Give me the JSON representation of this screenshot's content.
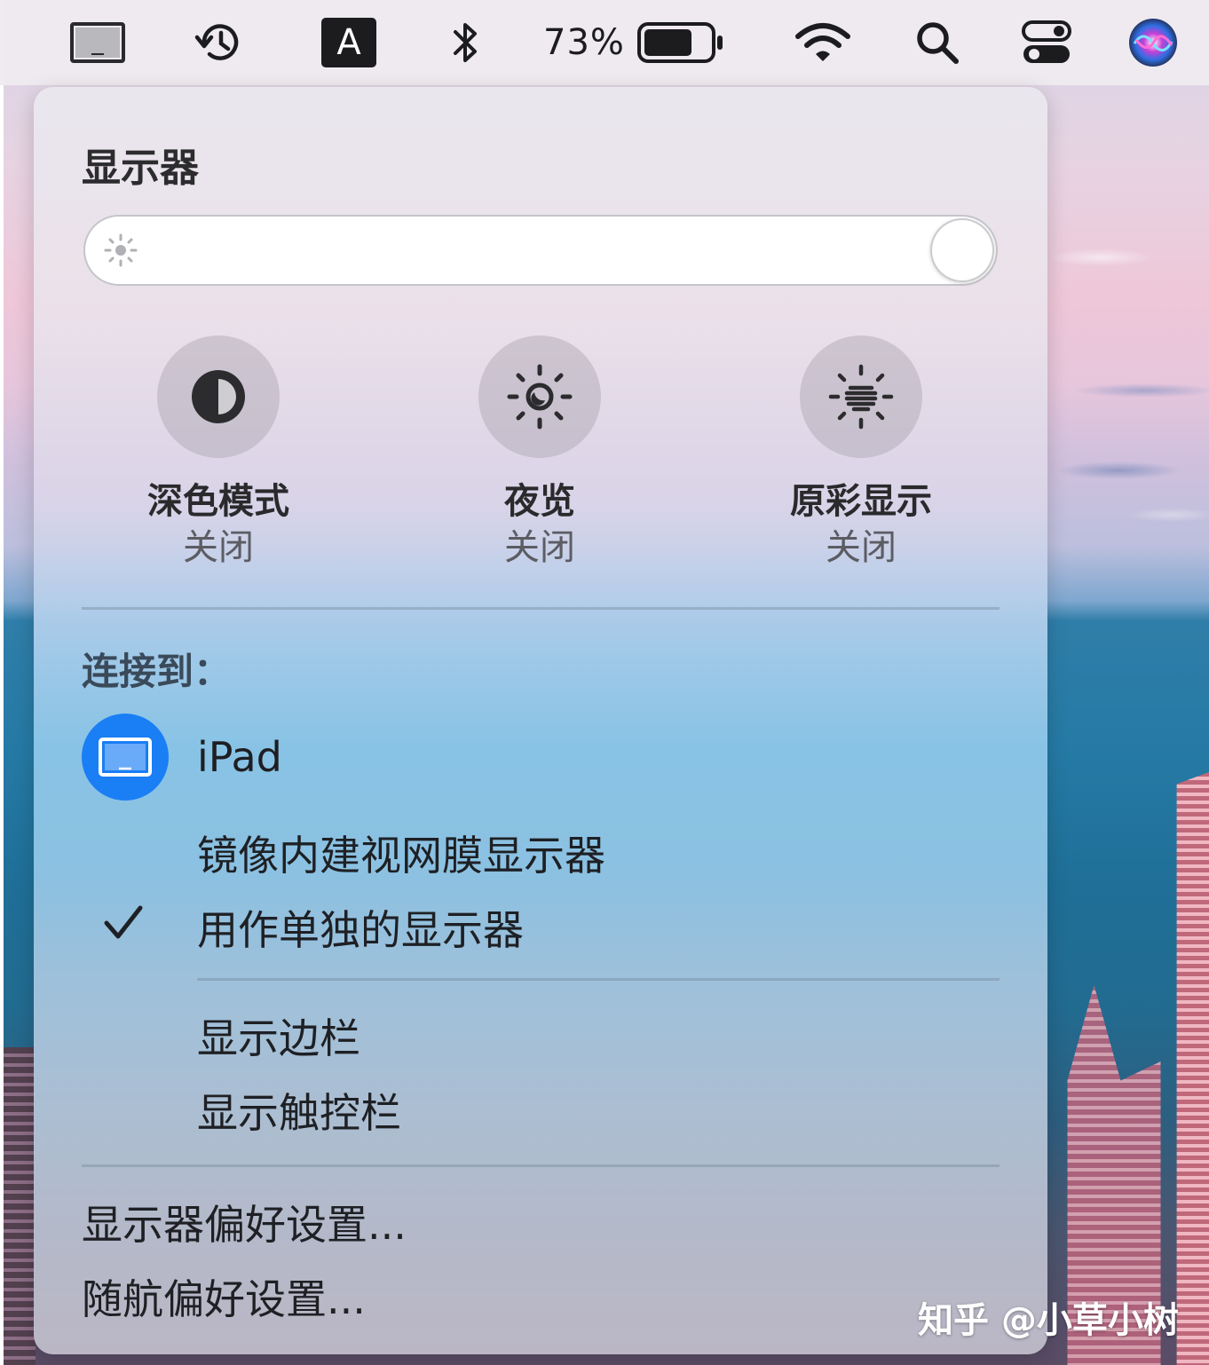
{
  "menubar": {
    "items": [
      {
        "name": "display-mirror-icon"
      },
      {
        "name": "time-machine-icon"
      },
      {
        "name": "input-source-icon",
        "label": "A"
      },
      {
        "name": "bluetooth-icon"
      },
      {
        "name": "battery",
        "percent_label": "73%",
        "level": 0.73
      },
      {
        "name": "wifi-icon"
      },
      {
        "name": "spotlight-search-icon"
      },
      {
        "name": "control-center-icon"
      },
      {
        "name": "siri-icon"
      }
    ]
  },
  "panel": {
    "title": "显示器",
    "brightness": {
      "icon": "sun-icon",
      "level": 1.0
    },
    "modes": [
      {
        "icon": "dark-mode-icon",
        "name": "深色模式",
        "state": "关闭"
      },
      {
        "icon": "night-shift-icon",
        "name": "夜览",
        "state": "关闭"
      },
      {
        "icon": "true-tone-icon",
        "name": "原彩显示",
        "state": "关闭"
      }
    ],
    "connect_label": "连接到：",
    "device": {
      "icon": "ipad-icon",
      "name": "iPad"
    },
    "options": [
      {
        "label": "镜像内建视网膜显示器",
        "checked": false
      },
      {
        "label": "用作单独的显示器",
        "checked": true
      }
    ],
    "extras": [
      {
        "label": "显示边栏"
      },
      {
        "label": "显示触控栏"
      }
    ],
    "preferences": [
      {
        "label": "显示器偏好设置..."
      },
      {
        "label": "随航偏好设置..."
      }
    ]
  },
  "watermark": "知乎 @小草小树",
  "colors": {
    "accent_blue": "#1a7ef5",
    "menubar_bg": "#eeeaf0"
  }
}
